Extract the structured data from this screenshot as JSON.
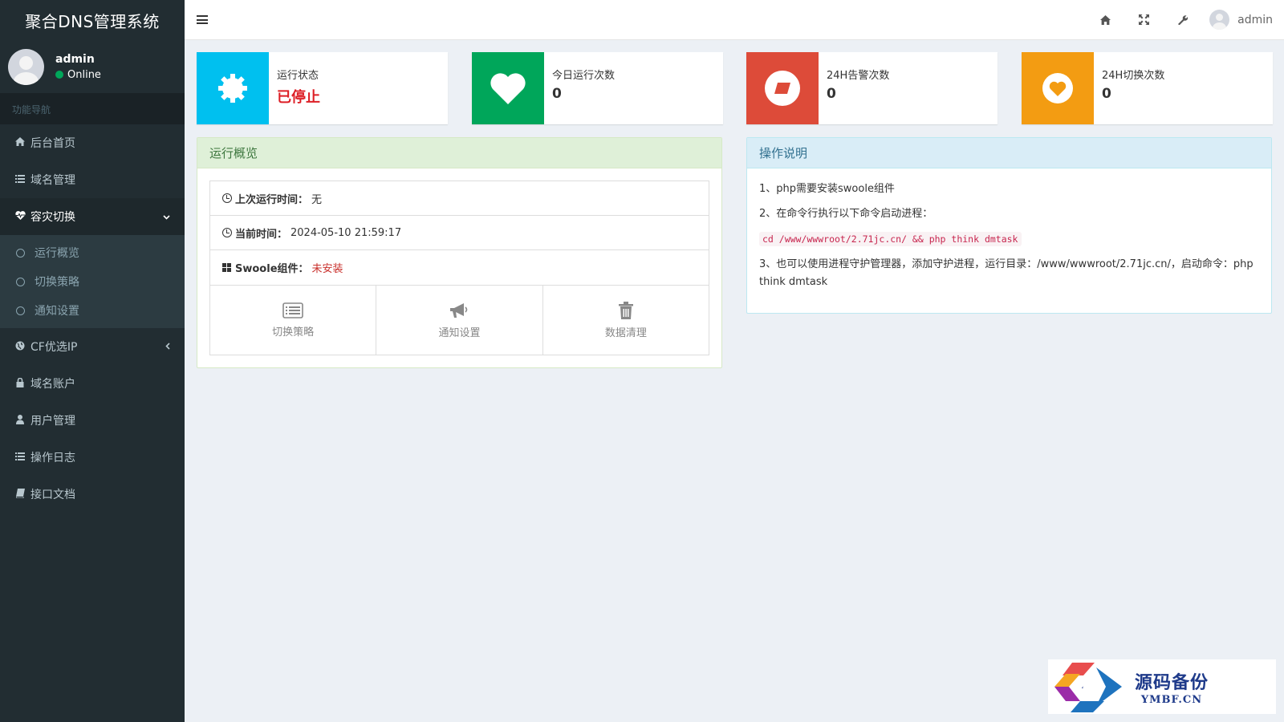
{
  "brand": {
    "title": "聚合DNS管理系统"
  },
  "user": {
    "name": "admin",
    "status": "Online"
  },
  "sidebar": {
    "header": "功能导航",
    "items": [
      {
        "label": "后台首页",
        "icon": "home-icon"
      },
      {
        "label": "域名管理",
        "icon": "list-icon"
      },
      {
        "label": "容灾切换",
        "icon": "heartbeat-icon",
        "expanded": true,
        "children": [
          {
            "label": "运行概览"
          },
          {
            "label": "切换策略"
          },
          {
            "label": "通知设置"
          }
        ]
      },
      {
        "label": "CF优选IP",
        "icon": "globe-icon"
      },
      {
        "label": "域名账户",
        "icon": "lock-icon"
      },
      {
        "label": "用户管理",
        "icon": "user-icon"
      },
      {
        "label": "操作日志",
        "icon": "list-icon"
      },
      {
        "label": "接口文档",
        "icon": "book-icon"
      }
    ]
  },
  "topbar": {
    "username": "admin",
    "icons": [
      "home-icon",
      "fullscreen-icon",
      "wrench-icon"
    ]
  },
  "stats": [
    {
      "label": "运行状态",
      "value": "已停止",
      "color": "#00c0ef",
      "icon": "gear-icon"
    },
    {
      "label": "今日运行次数",
      "value": "0",
      "color": "#00a65a",
      "icon": "heart-icon"
    },
    {
      "label": "24H告警次数",
      "value": "0",
      "color": "#dd4b39",
      "icon": "eraser-icon"
    },
    {
      "label": "24H切换次数",
      "value": "0",
      "color": "#f39c12",
      "icon": "heart-circle-icon"
    }
  ],
  "overview": {
    "title": "运行概览",
    "last_run_label": "上次运行时间：",
    "last_run_value": "无",
    "now_label": "当前时间：",
    "now_value": "2024-05-10 21:59:17",
    "swoole_label": "Swoole组件：",
    "swoole_value": "未安装",
    "actions": [
      "切换策略",
      "通知设置",
      "数据清理"
    ]
  },
  "help": {
    "title": "操作说明",
    "line1": "1、php需要安装swoole组件",
    "line2": "2、在命令行执行以下命令启动进程：",
    "code": "cd /www/wwwroot/2.71jc.cn/ && php think dmtask",
    "line3": "3、也可以使用进程守护管理器，添加守护进程，运行目录：/www/wwwroot/2.71jc.cn/，启动命令：php think dmtask"
  },
  "watermark": {
    "cn": "源码备份",
    "en": "YMBF.CN"
  }
}
